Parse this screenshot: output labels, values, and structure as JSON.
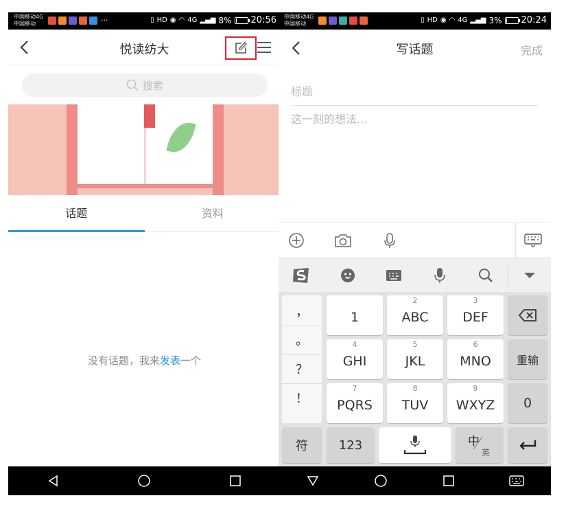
{
  "left": {
    "status": {
      "carrier_line1": "中国移动4G",
      "carrier_line2": "中国移动",
      "more": "···",
      "network": "4G",
      "battery_label": "8%",
      "battery_level": 0.08,
      "time": "20:56"
    },
    "nav": {
      "title": "悦读纺大",
      "back_icon": "back-chevron-icon",
      "edit_icon": "edit-icon",
      "menu_icon": "menu-icon"
    },
    "search": {
      "placeholder": "搜索"
    },
    "tabs": [
      {
        "label": "话题",
        "active": true
      },
      {
        "label": "资料",
        "active": false
      }
    ],
    "empty": {
      "prefix": "没有话题，我来",
      "link": "发表",
      "suffix": "一个"
    }
  },
  "right": {
    "status": {
      "carrier_line1": "中国移动4G",
      "carrier_line2": "中国移动",
      "network": "4G",
      "battery_label": "3%",
      "battery_level": 0.03,
      "time": "20:24"
    },
    "nav": {
      "title": "写话题",
      "done": "完成"
    },
    "form": {
      "title_placeholder": "标题",
      "body_placeholder": "这一刻的想法..."
    },
    "keyboard": {
      "symbols": [
        "，",
        "。",
        "？",
        "！"
      ],
      "rows": [
        [
          {
            "num": "",
            "label": "1"
          },
          {
            "num": "2",
            "label": "ABC"
          },
          {
            "num": "3",
            "label": "DEF"
          }
        ],
        [
          {
            "num": "4",
            "label": "GHI"
          },
          {
            "num": "5",
            "label": "JKL"
          },
          {
            "num": "6",
            "label": "MNO"
          }
        ],
        [
          {
            "num": "7",
            "label": "PQRS"
          },
          {
            "num": "8",
            "label": "TUV"
          },
          {
            "num": "9",
            "label": "WXYZ"
          }
        ]
      ],
      "reenter": "重输",
      "zero": "0",
      "symbol_key": "符",
      "num_key": "123",
      "lang_main": "中",
      "lang_sub": "英"
    }
  },
  "colors": {
    "accent_blue": "#2f96d4",
    "highlight_red": "#d9262a",
    "banner_bg": "#f6c3b7",
    "banner_frame": "#ef8c87"
  }
}
